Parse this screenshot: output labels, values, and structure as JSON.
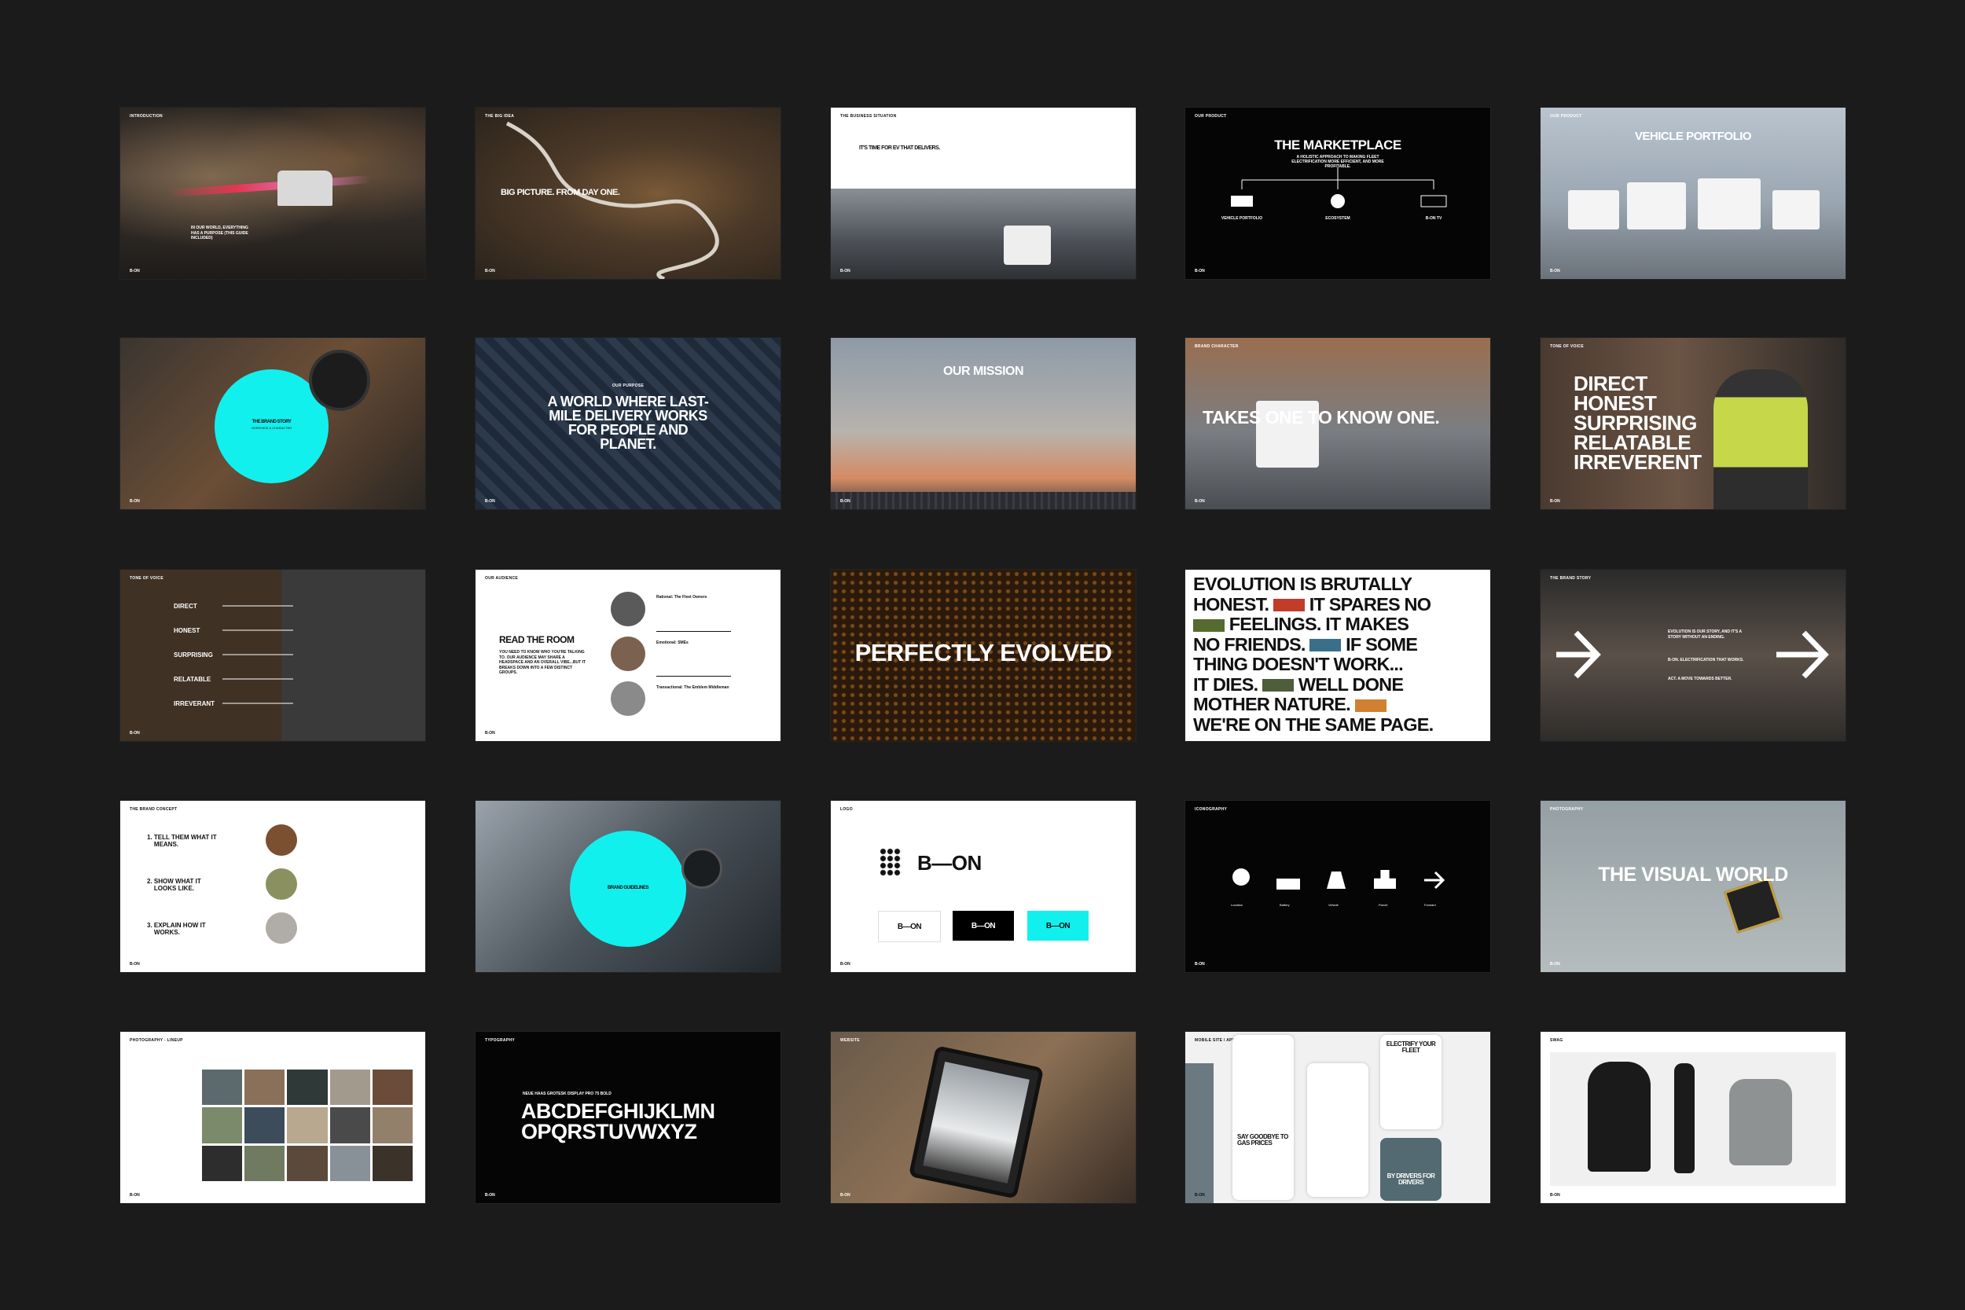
{
  "slides": {
    "s1": {
      "label": "INTRODUCTION",
      "text": "IN OUR WORLD, EVERYTHING HAS A PURPOSE (THIS GUIDE INCLUDED)",
      "foot": "B-ON"
    },
    "s2": {
      "label": "THE BIG IDEA",
      "title": "BIG PICTURE. FROM DAY ONE.",
      "foot": "B-ON"
    },
    "s3": {
      "label": "THE BUSINESS SITUATION",
      "title": "IT'S TIME FOR EV THAT DELIVERS.",
      "foot": "B-ON"
    },
    "s4": {
      "label": "OUR PRODUCT",
      "title": "THE MARKETPLACE",
      "subtitle": "A HOLISTIC APPROACH TO MAKING FLEET ELECTRIFICATION MORE EFFICIENT, AND MORE PROFITABLE.",
      "items": [
        "VEHICLE PORTFOLIO",
        "ECOSYSTEM",
        "B-ON TV"
      ],
      "foot": "B-ON"
    },
    "s5": {
      "label": "OUR PRODUCT",
      "title": "VEHICLE PORTFOLIO",
      "foot": "B-ON"
    },
    "s6": {
      "title": "THE BRAND STORY",
      "subtitle": "OVERVIEW & CHARACTER",
      "foot": "B-ON"
    },
    "s7": {
      "label": "OUR PURPOSE",
      "title": "A WORLD WHERE LAST-MILE DELIVERY WORKS FOR PEOPLE AND PLANET.",
      "foot": "B-ON"
    },
    "s8": {
      "title": "OUR MISSION",
      "foot": "B-ON"
    },
    "s9": {
      "label": "BRAND CHARACTER",
      "title": "TAKES ONE TO KNOW ONE.",
      "foot": "B-ON"
    },
    "s10": {
      "label": "TONE OF VOICE",
      "lines": [
        "DIRECT",
        "HONEST",
        "SURPRISING",
        "RELATABLE",
        "IRREVERENT"
      ],
      "foot": "B-ON"
    },
    "s11": {
      "label": "TONE OF VOICE",
      "items": [
        "DIRECT",
        "HONEST",
        "SURPRISING",
        "RELATABLE",
        "IRREVERANT"
      ],
      "foot": "B-ON"
    },
    "s12": {
      "label": "OUR AUDIENCE",
      "title": "READ THE ROOM",
      "body": "YOU NEED TO KNOW WHO YOU'RE TALKING TO. OUR AUDIENCE MAY SHARE A HEADSPACE AND AN OVERALL VIBE...BUT IT BREAKS DOWN INTO A FEW DISTINCT GROUPS.",
      "groups": [
        "Rational: The Fleet Owners",
        "Emotional: SMEs",
        "Transactional: The Emblem Middleman"
      ],
      "foot": "B-ON"
    },
    "s13": {
      "title": "PERFECTLY EVOLVED"
    },
    "s14": {
      "lines": [
        "EVOLUTION IS BRUTALLY",
        "HONEST.",
        "IT SPARES NO",
        "FEELINGS. IT MAKES",
        "NO FRIENDS.",
        "IF SOME",
        "THING DOESN'T WORK...",
        "IT DIES.",
        "WELL DONE",
        "MOTHER NATURE.",
        "WE'RE ON THE SAME PAGE."
      ]
    },
    "s15": {
      "label": "THE BRAND STORY",
      "text": "EVOLUTION IS OUR STORY, AND IT'S A STORY WITHOUT AN ENDING.",
      "tagline": "B-ON. ELECTRIFICATION THAT WORKS.",
      "tagline2": "ACT. A MOVE TOWARDS BETTER."
    },
    "s16": {
      "label": "THE BRAND CONCEPT",
      "items": [
        {
          "n": "1.",
          "t": "TELL THEM WHAT IT MEANS."
        },
        {
          "n": "2.",
          "t": "SHOW WHAT IT LOOKS LIKE."
        },
        {
          "n": "3.",
          "t": "EXPLAIN HOW IT WORKS."
        }
      ],
      "foot": "B-ON"
    },
    "s17": {
      "title": "BRAND GUIDELINES"
    },
    "s18": {
      "label": "LOGO",
      "logo": "B—ON",
      "variants": [
        "B—ON",
        "B—ON",
        "B—ON"
      ],
      "foot": "B-ON"
    },
    "s19": {
      "label": "ICONOGRAPHY",
      "icons": [
        "Location",
        "Battery",
        "Vehicle",
        "Parcel",
        "Forward"
      ],
      "foot": "B-ON"
    },
    "s20": {
      "label": "PHOTOGRAPHY",
      "title": "THE VISUAL WORLD",
      "foot": "B-ON"
    },
    "s21": {
      "label": "PHOTOGRAPHY - LINEUP",
      "foot": "B-ON"
    },
    "s22": {
      "label": "TYPOGRAPHY",
      "fontname": "NEUE HAAS GROTESK DISPLAY PRO 75 BOLD",
      "line1": "ABCDEFGHIJKLMN",
      "line2": "OPQRSTUVWXYZ",
      "foot": "B-ON"
    },
    "s23": {
      "label": "WEBSITE",
      "foot": "B-ON"
    },
    "s24": {
      "label": "MOBILE SITE / APP",
      "cards": [
        "SAY GOODBYE TO GAS PRICES",
        "ELECTRIFY YOUR FLEET",
        "BY DRIVERS FOR DRIVERS"
      ],
      "foot": "B-ON"
    },
    "s25": {
      "label": "SWAG",
      "foot": "B-ON"
    }
  },
  "colors": {
    "accent": "#12f0ee",
    "bg": "#1b1b1b"
  }
}
